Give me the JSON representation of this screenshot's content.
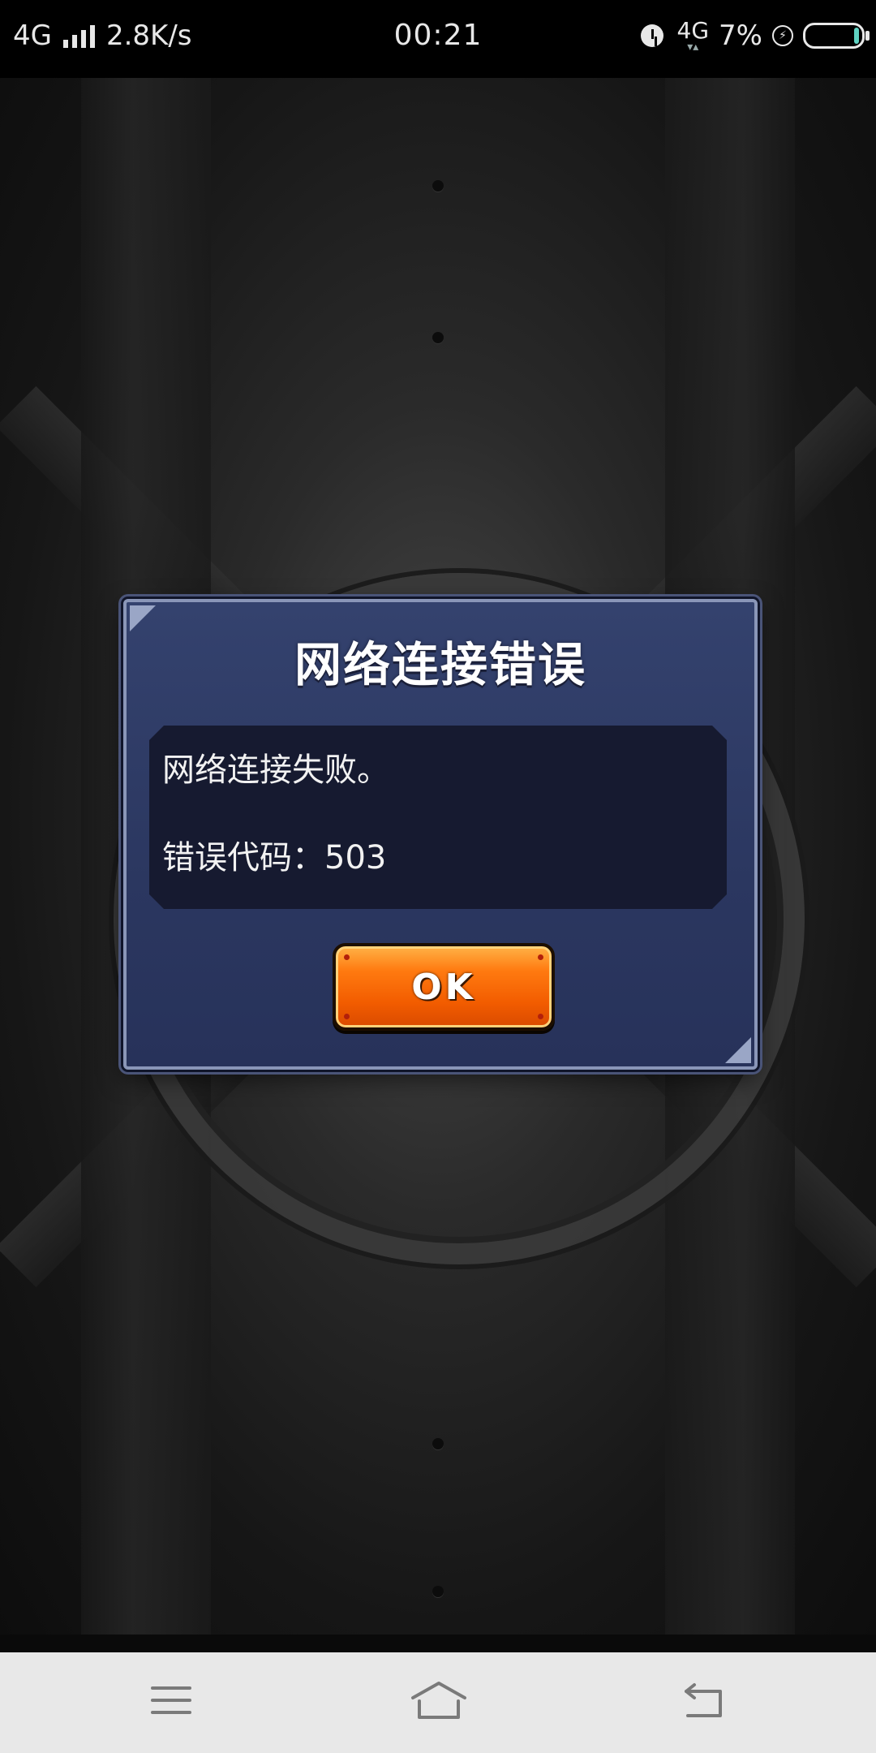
{
  "status_bar": {
    "network": "4G",
    "speed": "2.8K/s",
    "time": "00:21",
    "network_right": "4G",
    "battery": "7%"
  },
  "dialog": {
    "title": "网络连接错误",
    "message": "网络连接失败。",
    "error_code": "错误代码：503",
    "ok_label": "OK"
  },
  "navbar": {
    "icons": [
      "menu-icon",
      "home-icon",
      "back-icon"
    ]
  },
  "colors": {
    "dialog_bg": "#2e3a64",
    "message_bg": "#161a30",
    "ok_button": "#f25c00",
    "navbar_bg": "#e8e8e8"
  }
}
